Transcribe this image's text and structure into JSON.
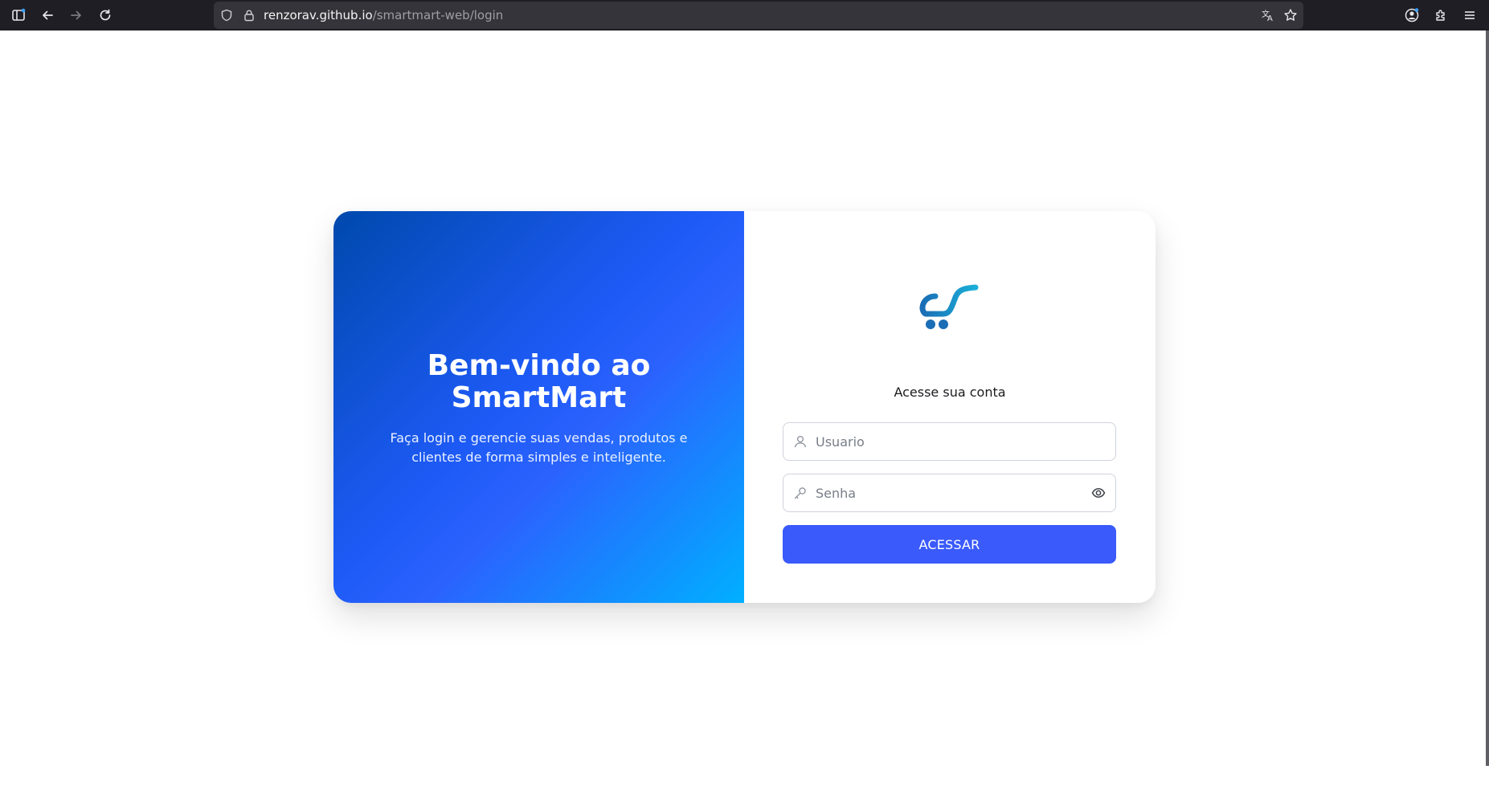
{
  "browser": {
    "url_host": "renzorav.github.io",
    "url_path": "/smartmart-web/login",
    "icons": [
      "sidebar-icon",
      "back-icon",
      "forward-icon",
      "reload-icon",
      "shield-icon",
      "lock-icon",
      "translate-icon",
      "bookmark-star-icon",
      "account-icon",
      "extensions-icon",
      "menu-icon"
    ]
  },
  "hero": {
    "title": "Bem-vindo ao SmartMart",
    "subtitle": "Faça login e gerencie suas vendas, produtos e clientes de forma simples e inteligente."
  },
  "login": {
    "heading": "Acesse sua conta",
    "username_placeholder": "Usuario",
    "username_value": "",
    "password_placeholder": "Senha",
    "password_value": "",
    "submit_label": "ACESSAR"
  },
  "colors": {
    "chrome": "#1f1e25",
    "urlbar": "#35343a",
    "hero_gradient_start": "#0049ad",
    "hero_gradient_mid": "#2b62fe",
    "hero_gradient_end": "#00b0ff",
    "button": "#3a5afc",
    "logo_dark": "#1a6eb5",
    "logo_light": "#1ab0d8"
  }
}
